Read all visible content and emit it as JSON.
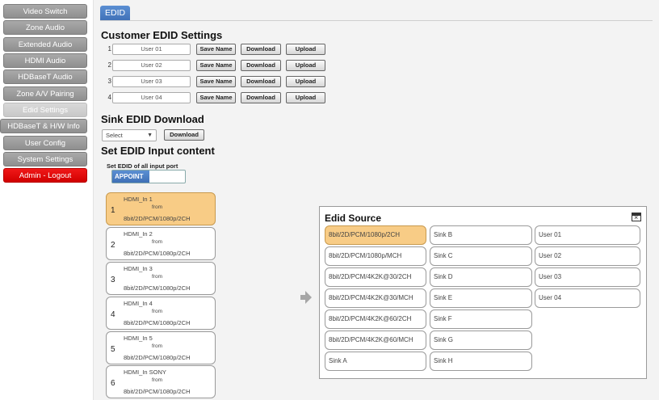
{
  "sidebar": {
    "items": [
      {
        "label": "Video Switch",
        "state": "normal"
      },
      {
        "label": "Zone Audio",
        "state": "normal"
      },
      {
        "label": "Extended Audio",
        "state": "normal"
      },
      {
        "label": "HDMI Audio",
        "state": "normal"
      },
      {
        "label": "HDBaseT Audio",
        "state": "normal"
      },
      {
        "label": "Zone A/V Pairing",
        "state": "normal"
      },
      {
        "label": "Edid Settings",
        "state": "active"
      },
      {
        "label": "HDBaseT & H/W Info",
        "state": "normal"
      },
      {
        "label": "User Config",
        "state": "normal"
      },
      {
        "label": "System Settings",
        "state": "normal"
      },
      {
        "label": "Admin - Logout",
        "state": "logout"
      }
    ]
  },
  "tab": {
    "label": "EDID"
  },
  "customer": {
    "title": "Customer EDID Settings",
    "save_label": "Save Name",
    "download_label": "Download",
    "upload_label": "Upload",
    "rows": [
      {
        "num": "1",
        "name": "User 01"
      },
      {
        "num": "2",
        "name": "User 02"
      },
      {
        "num": "3",
        "name": "User 03"
      },
      {
        "num": "4",
        "name": "User 04"
      }
    ]
  },
  "sink": {
    "title": "Sink EDID Download",
    "select_value": "Select",
    "download_label": "Download"
  },
  "input_content": {
    "title": "Set EDID Input content",
    "set_all_label": "Set EDID of all input port",
    "toggle_label": "APPOINT"
  },
  "ports": [
    {
      "num": "1",
      "name": "HDMI_In 1",
      "from": "from",
      "format": "8bit/2D/PCM/1080p/2CH",
      "selected": true
    },
    {
      "num": "2",
      "name": "HDMI_In 2",
      "from": "from",
      "format": "8bit/2D/PCM/1080p/2CH",
      "selected": false
    },
    {
      "num": "3",
      "name": "HDMI_In 3",
      "from": "from",
      "format": "8bit/2D/PCM/1080p/2CH",
      "selected": false
    },
    {
      "num": "4",
      "name": "HDMI_In 4",
      "from": "from",
      "format": "8bit/2D/PCM/1080p/2CH",
      "selected": false
    },
    {
      "num": "5",
      "name": "HDMI_In 5",
      "from": "from",
      "format": "8bit/2D/PCM/1080p/2CH",
      "selected": false
    },
    {
      "num": "6",
      "name": "HDMI_In SONY",
      "from": "from",
      "format": "8bit/2D/PCM/1080p/2CH",
      "selected": false
    }
  ],
  "source": {
    "title": "Edid Source",
    "columns": [
      [
        "8bit/2D/PCM/1080p/2CH",
        "8bit/2D/PCM/1080p/MCH",
        "8bit/2D/PCM/4K2K@30/2CH",
        "8bit/2D/PCM/4K2K@30/MCH",
        "8bit/2D/PCM/4K2K@60/2CH",
        "8bit/2D/PCM/4K2K@60/MCH",
        "Sink A"
      ],
      [
        "Sink B",
        "Sink C",
        "Sink D",
        "Sink E",
        "Sink F",
        "Sink G",
        "Sink H"
      ],
      [
        "User 01",
        "User 02",
        "User 03",
        "User 04"
      ]
    ],
    "selected": "8bit/2D/PCM/1080p/2CH"
  }
}
